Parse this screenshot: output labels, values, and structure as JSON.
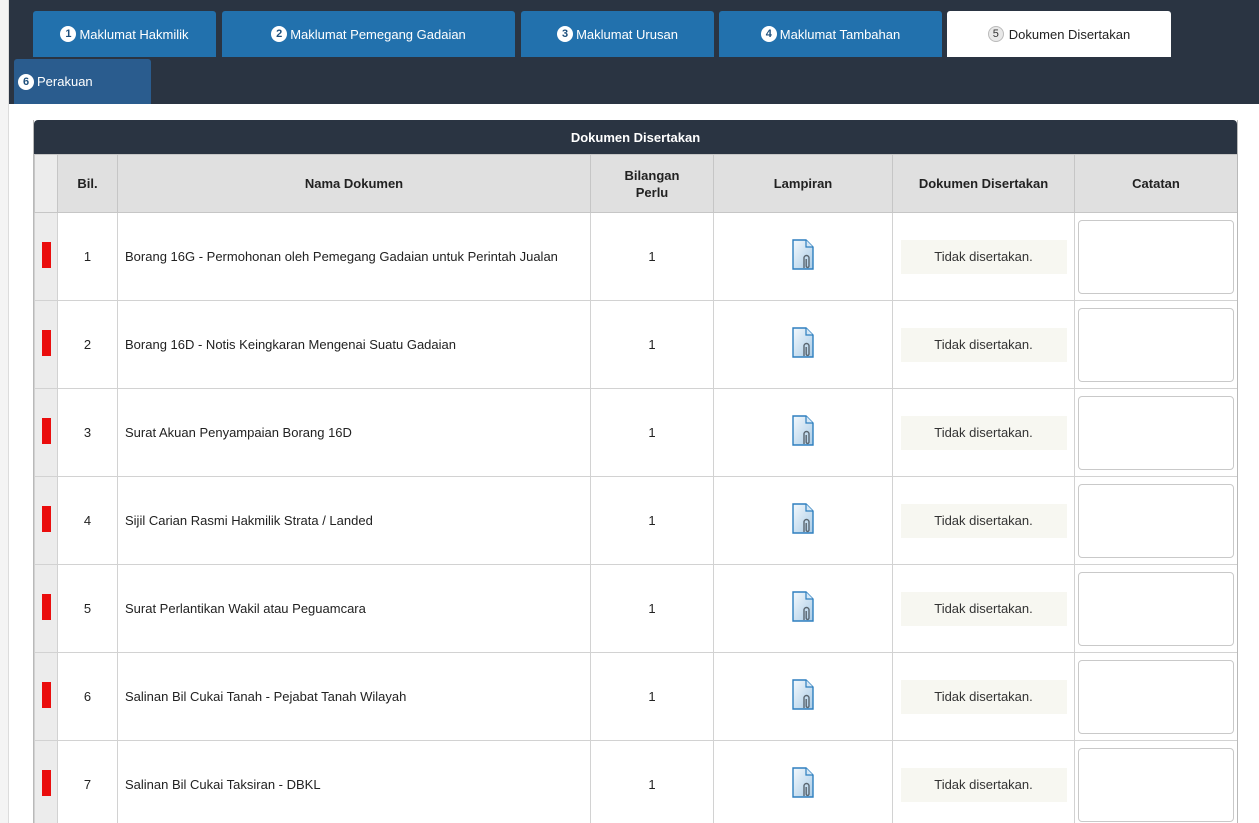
{
  "tabs": [
    {
      "num": "1",
      "label": "Maklumat Hakmilik"
    },
    {
      "num": "2",
      "label": "Maklumat Pemegang Gadaian"
    },
    {
      "num": "3",
      "label": "Maklumat Urusan"
    },
    {
      "num": "4",
      "label": "Maklumat Tambahan"
    },
    {
      "num": "5",
      "label": "Dokumen Disertakan"
    },
    {
      "num": "6",
      "label": "Perakuan"
    }
  ],
  "active_tab": "Dokumen Disertakan",
  "panel": {
    "title": "Dokumen Disertakan"
  },
  "columns": {
    "bil": "Bil.",
    "nama": "Nama Dokumen",
    "bilangan_1": "Bilangan",
    "bilangan_2": "Perlu",
    "lampiran": "Lampiran",
    "disertakan": "Dokumen Disertakan",
    "catatan": "Catatan"
  },
  "rows": [
    {
      "bil": "1",
      "name": "Borang 16G - Permohonan oleh Pemegang Gadaian untuk Perintah Jualan",
      "count": "1",
      "status": "Tidak disertakan.",
      "note": ""
    },
    {
      "bil": "2",
      "name": "Borang 16D - Notis Keingkaran Mengenai Suatu Gadaian",
      "count": "1",
      "status": "Tidak disertakan.",
      "note": ""
    },
    {
      "bil": "3",
      "name": "Surat Akuan Penyampaian Borang 16D",
      "count": "1",
      "status": "Tidak disertakan.",
      "note": ""
    },
    {
      "bil": "4",
      "name": "Sijil Carian Rasmi Hakmilik Strata / Landed",
      "count": "1",
      "status": "Tidak disertakan.",
      "note": ""
    },
    {
      "bil": "5",
      "name": "Surat Perlantikan Wakil atau Peguamcara",
      "count": "1",
      "status": "Tidak disertakan.",
      "note": ""
    },
    {
      "bil": "6",
      "name": "Salinan Bil Cukai Tanah - Pejabat Tanah Wilayah",
      "count": "1",
      "status": "Tidak disertakan.",
      "note": ""
    },
    {
      "bil": "7",
      "name": "Salinan Bil Cukai Taksiran - DBKL",
      "count": "1",
      "status": "Tidak disertakan.",
      "note": ""
    }
  ],
  "icons": {
    "attachment": "paperclip-document-icon",
    "required_flag": "required-flag-icon"
  },
  "colors": {
    "tab_blue": "#2271ad",
    "header_dark": "#2a3442",
    "flag_red": "#ea0d0d"
  }
}
